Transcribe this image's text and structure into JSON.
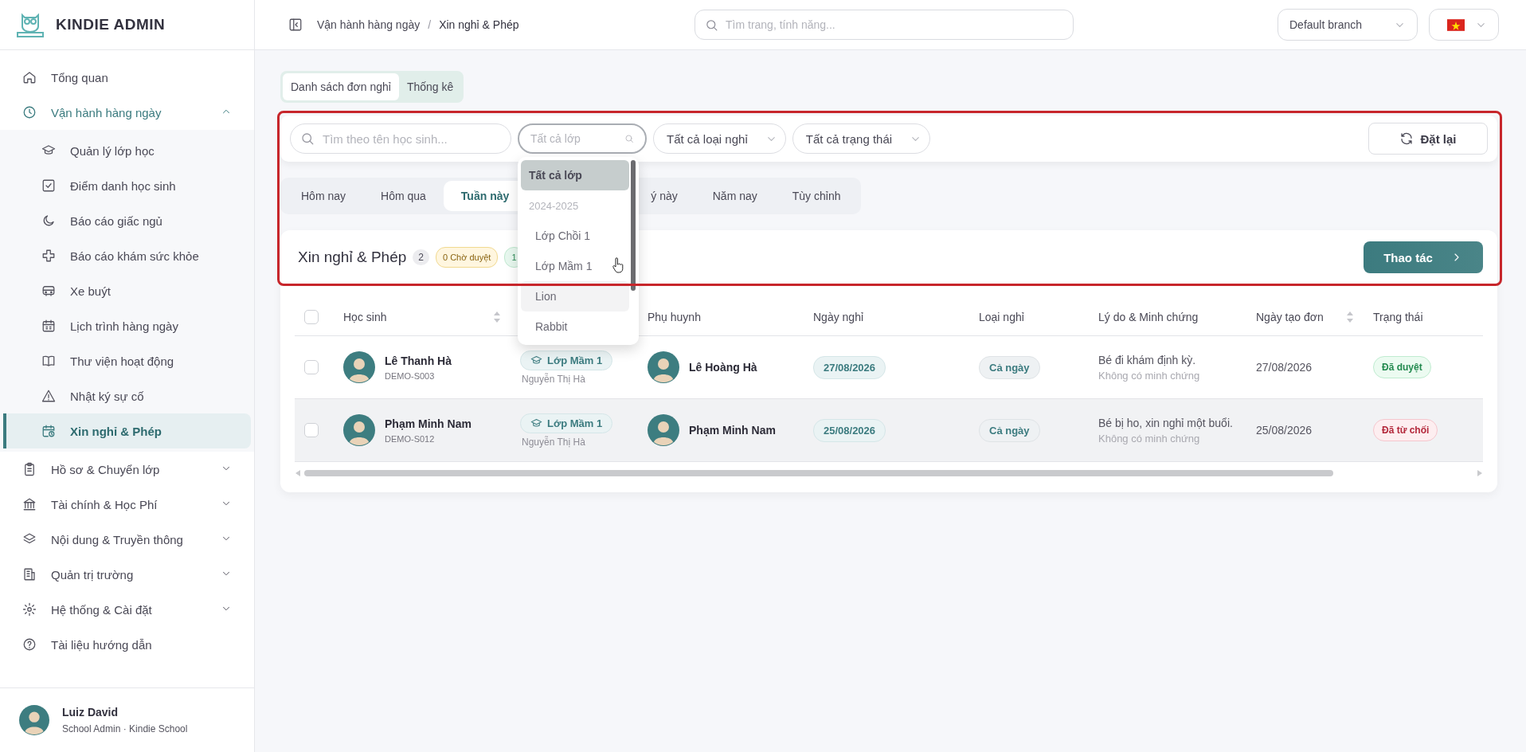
{
  "sidebar": {
    "brand": "KINDIE ADMIN",
    "items": [
      {
        "label": "Tổng quan",
        "selected": false
      },
      {
        "label": "Vận hành hàng ngày",
        "selected": false,
        "expanded": true,
        "children": [
          {
            "label": "Quản lý lớp học",
            "selected": false
          },
          {
            "label": "Điểm danh học sinh",
            "selected": false
          },
          {
            "label": "Báo cáo giấc ngủ",
            "selected": false
          },
          {
            "label": "Báo cáo khám sức khỏe",
            "selected": false
          },
          {
            "label": "Xe buýt",
            "selected": false
          },
          {
            "label": "Lịch trình hàng ngày",
            "selected": false
          },
          {
            "label": "Thư viện hoạt động",
            "selected": false
          },
          {
            "label": "Nhật ký sự cố",
            "selected": false
          },
          {
            "label": "Xin nghỉ & Phép",
            "selected": true
          }
        ]
      },
      {
        "label": "Hồ sơ & Chuyển lớp",
        "selected": false,
        "expanded": false
      },
      {
        "label": "Tài chính & Học Phí",
        "selected": false,
        "expanded": false
      },
      {
        "label": "Nội dung & Truyền thông",
        "selected": false,
        "expanded": false
      },
      {
        "label": "Quản trị trường",
        "selected": false,
        "expanded": false
      },
      {
        "label": "Hệ thống & Cài đặt",
        "selected": false,
        "expanded": false
      },
      {
        "label": "Tài liệu hướng dẫn",
        "selected": false
      }
    ],
    "user": {
      "name": "Luiz David",
      "role": "School Admin · Kindie School"
    }
  },
  "header": {
    "breadcrumb": [
      "Vận hành hàng ngày",
      "Xin nghỉ & Phép"
    ],
    "separator": "/",
    "search": {
      "placeholder": "Tìm trang, tính năng..."
    },
    "branch": "Default branch"
  },
  "page_tabs": [
    {
      "label": "Danh sách đơn nghỉ",
      "selected": true
    },
    {
      "label": "Thống kê",
      "selected": false
    }
  ],
  "filters": {
    "search": {
      "placeholder": "Tìm theo tên học sinh..."
    },
    "class_select": {
      "placeholder": "Tất cả lớp",
      "open": true,
      "options": [
        {
          "kind": "option",
          "label": "Tất cả lớp",
          "selected": true,
          "hovered": false
        },
        {
          "kind": "group",
          "label": "2024-2025"
        },
        {
          "kind": "option",
          "label": "Lớp Chồi 1",
          "selected": false,
          "hovered": false
        },
        {
          "kind": "option",
          "label": "Lớp Mầm 1",
          "selected": false,
          "hovered": false
        },
        {
          "kind": "option",
          "label": "Lion",
          "selected": false,
          "hovered": true
        },
        {
          "kind": "option",
          "label": "Rabbit",
          "selected": false,
          "hovered": false
        }
      ]
    },
    "type_select": "Tất cả loại nghỉ",
    "status_select": "Tất cả trạng thái",
    "reset": "Đặt lại"
  },
  "period_tabs": [
    {
      "label": "Hôm nay",
      "selected": false,
      "clipped": false
    },
    {
      "label": "Hôm qua",
      "selected": false,
      "clipped": false
    },
    {
      "label": "Tuần này",
      "selected": true,
      "clipped": false
    },
    {
      "label": "ý này",
      "selected": false,
      "clipped": true
    },
    {
      "label": "Năm nay",
      "selected": false,
      "clipped": false
    },
    {
      "label": "Tùy chỉnh",
      "selected": false,
      "clipped": false
    }
  ],
  "list": {
    "title": "Xin nghỉ & Phép",
    "count": "2",
    "chips": [
      {
        "label": "0 Chờ duyệt",
        "kind": "pending"
      },
      {
        "label": "1",
        "kind": "approved"
      }
    ],
    "action": "Thao tác"
  },
  "table": {
    "select_all_checked": false,
    "columns": [
      {
        "kind": "text",
        "label": "Học sinh",
        "sortable": true
      },
      {
        "kind": "covered"
      },
      {
        "kind": "text",
        "label": "Phụ huynh",
        "sortable": false
      },
      {
        "kind": "text",
        "label": "Ngày nghỉ",
        "sortable": false
      },
      {
        "kind": "text",
        "label": "Loại nghỉ",
        "sortable": false
      },
      {
        "kind": "text",
        "label": "Lý do & Minh chứng",
        "sortable": false
      },
      {
        "kind": "text",
        "label": "Ngày tạo đơn",
        "sortable": true
      },
      {
        "kind": "text",
        "label": "Trạng thái",
        "sortable": false
      }
    ],
    "rows": [
      {
        "checked": false,
        "hovered": false,
        "student": "Lê Thanh Hà",
        "student_id": "DEMO-S003",
        "class": "Lớp Mầm 1",
        "teacher": "Nguyễn Thị Hà",
        "parent": "Lê Hoàng Hà",
        "leave_date": "27/08/2026",
        "leave_type": "Cả ngày",
        "reason": "Bé đi khám định kỳ.",
        "evidence": "Không có minh chứng",
        "created": "27/08/2026",
        "status": {
          "label": "Đã duyệt",
          "kind": "approved"
        }
      },
      {
        "checked": false,
        "hovered": true,
        "student": "Phạm Minh Nam",
        "student_id": "DEMO-S012",
        "class": "Lớp Mầm 1",
        "teacher": "Nguyễn Thị Hà",
        "parent": "Phạm Minh Nam",
        "leave_date": "25/08/2026",
        "leave_type": "Cả ngày",
        "reason": "Bé bị ho, xin nghỉ một buổi.",
        "evidence": "Không có minh chứng",
        "created": "25/08/2026",
        "status": {
          "label": "Đã từ chối",
          "kind": "rejected"
        }
      }
    ]
  }
}
